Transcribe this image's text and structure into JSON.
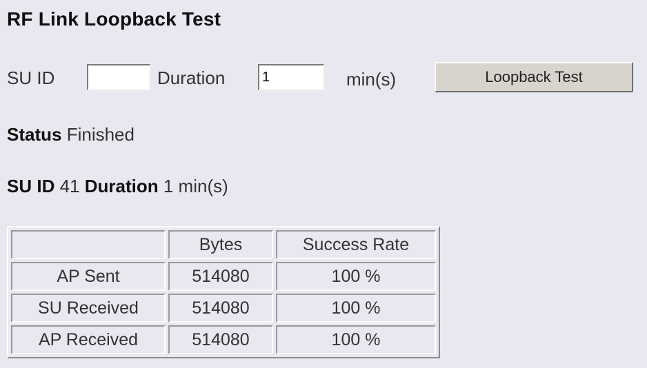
{
  "page": {
    "title": "RF Link Loopback Test"
  },
  "form": {
    "su_id_label": "SU ID",
    "su_id_value": "",
    "duration_label": "Duration",
    "duration_value": "1",
    "unit_label": "min(s)",
    "test_button_label": "Loopback Test"
  },
  "status": {
    "label": "Status",
    "value": "Finished"
  },
  "info": {
    "su_id_label": "SU ID",
    "su_id_value": "41",
    "duration_label": "Duration",
    "duration_value": "1 min(s)"
  },
  "table": {
    "headers": [
      "",
      "Bytes",
      "Success Rate"
    ],
    "rows": [
      [
        "AP Sent",
        "514080",
        "100 %"
      ],
      [
        "SU Received",
        "514080",
        "100 %"
      ],
      [
        "AP Received",
        "514080",
        "100 %"
      ]
    ]
  }
}
